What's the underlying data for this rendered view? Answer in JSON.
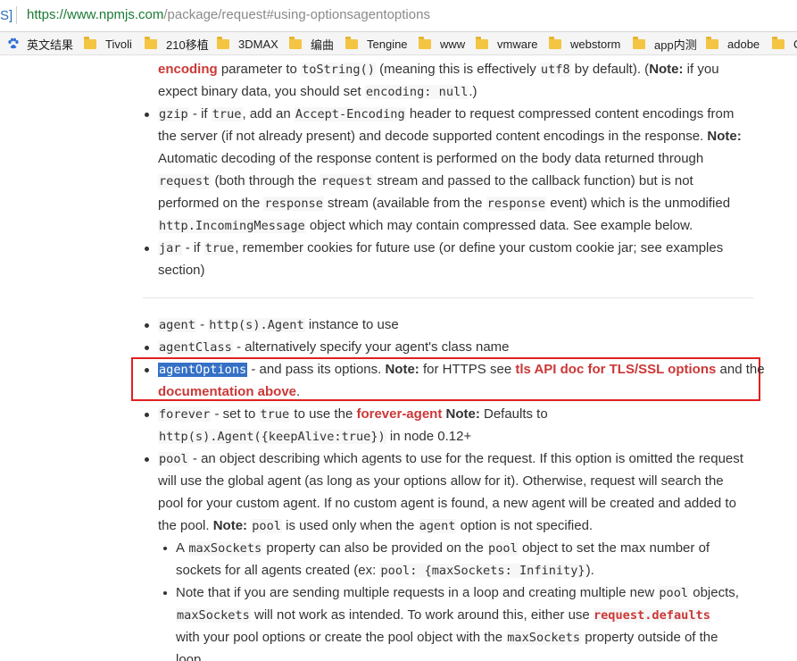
{
  "browser": {
    "tab_fragment": "S]",
    "url_base": "https://www.npmjs.com",
    "url_path": "/package/request#using-optionsagentoptions"
  },
  "bookmarks": [
    {
      "label": "英文结果",
      "icon": "baidu-paw-icon"
    },
    {
      "label": "Tivoli",
      "icon": "folder-icon"
    },
    {
      "label": "210移植",
      "icon": "folder-icon"
    },
    {
      "label": "3DMAX",
      "icon": "folder-icon"
    },
    {
      "label": "编曲",
      "icon": "folder-icon"
    },
    {
      "label": "Tengine",
      "icon": "folder-icon"
    },
    {
      "label": "www",
      "icon": "folder-icon"
    },
    {
      "label": "vmware",
      "icon": "folder-icon"
    },
    {
      "label": "webstorm",
      "icon": "folder-icon"
    },
    {
      "label": "app内测",
      "icon": "folder-icon"
    },
    {
      "label": "adobe",
      "icon": "folder-icon"
    },
    {
      "label": "C",
      "icon": "folder-icon"
    }
  ],
  "doc": {
    "encoding": {
      "l1": [
        "encoding",
        " parameter to ",
        "toString()",
        " (meaning this is effectively ",
        "utf8",
        " by default). (",
        "Note:",
        " if you"
      ],
      "l2": [
        "expect binary data, you should set ",
        "encoding: null",
        ".)"
      ]
    },
    "gzip": {
      "l1": [
        "gzip",
        " - if ",
        "true",
        ", add an ",
        "Accept-Encoding",
        " header to request compressed content encodings from"
      ],
      "l2": [
        "the server (if not already present) and decode supported content encodings in the response. ",
        "Note:"
      ],
      "l3": [
        "Automatic decoding of the response content is performed on the body data returned through"
      ],
      "l4": [
        "request",
        " (both through the ",
        "request",
        " stream and passed to the callback function) but is not"
      ],
      "l5": [
        "performed on the ",
        "response",
        " stream (available from the ",
        "response",
        " event) which is the unmodified"
      ],
      "l6": [
        "http.IncomingMessage",
        " object which may contain compressed data. See example below."
      ]
    },
    "jar": {
      "l1": [
        "jar",
        " - if ",
        "true",
        ", remember cookies for future use (or define your custom cookie jar; see examples"
      ],
      "l2": [
        "section)"
      ]
    },
    "agent": [
      "agent",
      " - ",
      "http(s).Agent",
      " instance to use"
    ],
    "agentClass": [
      "agentClass",
      " - alternatively specify your agent's class name"
    ],
    "agentOptions": {
      "l1": [
        "agentOptions",
        " - and pass its options. ",
        "Note:",
        " for HTTPS see ",
        "tls API doc for TLS/SSL options",
        " and the"
      ],
      "l2": [
        "documentation above",
        "."
      ]
    },
    "forever": {
      "l1": [
        "forever",
        " - set to ",
        "true",
        " to use the ",
        "forever-agent",
        " ",
        "Note:",
        " Defaults to"
      ],
      "l2": [
        "http(s).Agent({keepAlive:true})",
        " in node 0.12+"
      ]
    },
    "pool": {
      "l1": [
        "pool",
        " - an object describing which agents to use for the request. If this option is omitted the request"
      ],
      "l2": [
        "will use the global agent (as long as your options allow for it). Otherwise, request will search the"
      ],
      "l3": [
        "pool for your custom agent. If no custom agent is found, a new agent will be created and added to"
      ],
      "l4": [
        "the pool. ",
        "Note:",
        " ",
        "pool",
        " is used only when the ",
        "agent",
        " option is not specified."
      ]
    },
    "sub1": {
      "l1": [
        "A ",
        "maxSockets",
        " property can also be provided on the ",
        "pool",
        " object to set the max number of"
      ],
      "l2": [
        "sockets for all agents created (ex: ",
        "pool: {maxSockets: Infinity}",
        ")."
      ]
    },
    "sub2": {
      "l1": [
        "Note that if you are sending multiple requests in a loop and creating multiple new ",
        "pool",
        " objects,"
      ],
      "l2": [
        "maxSockets",
        " will not work as intended. To work around this, either use ",
        "request.defaults"
      ],
      "l3": [
        "with your pool options or create the pool object with the ",
        "maxSockets",
        " property outside of the"
      ],
      "l4": [
        "loop."
      ]
    }
  }
}
